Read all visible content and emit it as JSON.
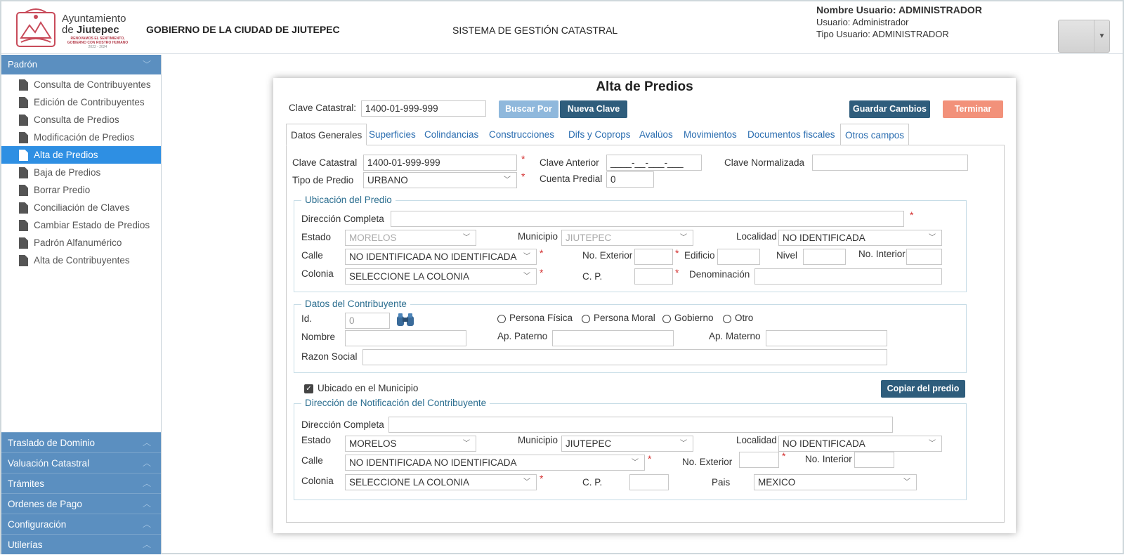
{
  "header": {
    "ayuntamiento_line1": "Ayuntamiento",
    "ayuntamiento_line2_prefix": "de ",
    "ayuntamiento_line2_name": "Jiutepec",
    "slogan_line1": "RENOVAMOS EL SENTIMIENTO,",
    "slogan_line2": "GOBIERNO CON ROSTRO HUMANO",
    "slogan_years": "2022 - 2024",
    "government_title": "GOBIERNO DE LA CIUDAD DE JIUTEPEC",
    "system_title": "SISTEMA DE GESTIÓN CATASTRAL",
    "user_name": "Nombre Usuario: ADMINISTRADOR",
    "user": "Usuario: Administrador",
    "user_type": "Tipo Usuario: ADMINISTRADOR"
  },
  "sidebar": {
    "section": "Padrón",
    "items": [
      {
        "label": "Consulta de Contribuyentes"
      },
      {
        "label": "Edición de Contribuyentes"
      },
      {
        "label": "Consulta de Predios"
      },
      {
        "label": "Modificación de Predios"
      },
      {
        "label": "Alta de Predios"
      },
      {
        "label": "Baja de Predios"
      },
      {
        "label": "Borrar Predio"
      },
      {
        "label": "Conciliación de Claves"
      },
      {
        "label": "Cambiar Estado de Predios"
      },
      {
        "label": "Padrón Alfanumérico"
      },
      {
        "label": "Alta de Contribuyentes"
      }
    ],
    "sections": [
      {
        "label": "Traslado de Dominio"
      },
      {
        "label": "Valuación Catastral"
      },
      {
        "label": "Trámites"
      },
      {
        "label": "Ordenes de Pago"
      },
      {
        "label": "Configuración"
      },
      {
        "label": "Utilerías"
      }
    ]
  },
  "main": {
    "title": "Alta de Predios",
    "clave_label": "Clave Catastral:",
    "clave_value": "1400-01-999-999",
    "buscar_por": "Buscar Por",
    "nueva_clave": "Nueva Clave",
    "guardar": "Guardar Cambios",
    "terminar": "Terminar",
    "tabs": [
      {
        "label": "Datos Generales"
      },
      {
        "label": "Superficies"
      },
      {
        "label": "Colindancias"
      },
      {
        "label": "Construcciones"
      },
      {
        "label": "Difs y Coprops"
      },
      {
        "label": "Avalúos"
      },
      {
        "label": "Movimientos"
      },
      {
        "label": "Documentos fiscales"
      },
      {
        "label": "Otros campos"
      }
    ]
  },
  "general": {
    "clave_catastral_label": "Clave Catastral",
    "clave_catastral_value": "1400-01-999-999",
    "clave_anterior_label": "Clave Anterior",
    "clave_anterior_value": "____-__-___-___",
    "clave_normalizada_label": "Clave Normalizada",
    "tipo_predio_label": "Tipo de Predio",
    "tipo_predio_value": "URBANO",
    "cuenta_predial_label": "Cuenta Predial",
    "cuenta_predial_value": "0",
    "required_mark": "*"
  },
  "ubicacion": {
    "legend": "Ubicación del Predio",
    "direccion_label": "Dirección Completa",
    "estado_label": "Estado",
    "estado_value": "MORELOS",
    "municipio_label": "Municipio",
    "municipio_value": "JIUTEPEC",
    "localidad_label": "Localidad",
    "localidad_value": "NO IDENTIFICADA",
    "calle_label": "Calle",
    "calle_value": "NO IDENTIFICADA NO IDENTIFICADA",
    "no_exterior_label": "No. Exterior",
    "edificio_label": "Edificio",
    "nivel_label": "Nivel",
    "no_interior_label": "No. Interior",
    "colonia_label": "Colonia",
    "colonia_value": "SELECCIONE LA COLONIA",
    "cp_label": "C. P.",
    "denominacion_label": "Denominación"
  },
  "contribuyente": {
    "legend": "Datos del Contribuyente",
    "id_label": "Id.",
    "id_value": "0",
    "persona_fisica": "Persona Física",
    "persona_moral": "Persona Moral",
    "gobierno": "Gobierno",
    "otro": "Otro",
    "nombre_label": "Nombre",
    "ap_paterno_label": "Ap. Paterno",
    "ap_materno_label": "Ap. Materno",
    "razon_social_label": "Razon Social"
  },
  "municipio_check": {
    "label": "Ubicado en el Municipio",
    "copiar": "Copiar del predio"
  },
  "notificacion": {
    "legend": "Dirección de Notificación del Contribuyente",
    "direccion_label": "Dirección Completa",
    "estado_label": "Estado",
    "estado_value": "MORELOS",
    "municipio_label": "Municipio",
    "municipio_value": "JIUTEPEC",
    "localidad_label": "Localidad",
    "localidad_value": "NO IDENTIFICADA",
    "calle_label": "Calle",
    "calle_value": "NO IDENTIFICADA NO IDENTIFICADA",
    "no_exterior_label": "No. Exterior",
    "no_interior_label": "No. Interior",
    "colonia_label": "Colonia",
    "colonia_value": "SELECCIONE LA COLONIA",
    "cp_label": "C. P.",
    "pais_label": "Pais",
    "pais_value": "MEXICO"
  },
  "colors": {
    "sidebar_header": "#5b8fc0",
    "sidebar_active": "#2e8fe3",
    "button_dark": "#2f5d7c",
    "button_light": "#8fb8dc",
    "button_orange": "#f2917a",
    "required": "#d32f2f"
  }
}
